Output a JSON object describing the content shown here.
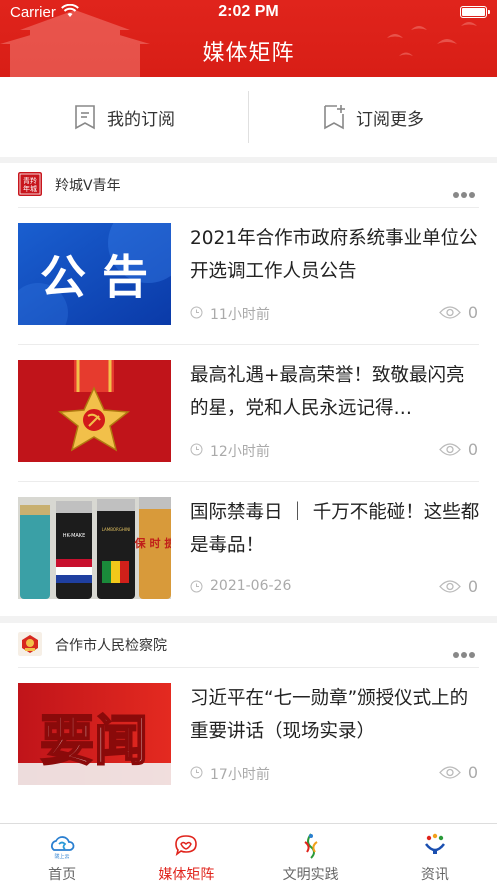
{
  "status_bar": {
    "carrier": "Carrier",
    "time": "2:02 PM"
  },
  "header": {
    "title": "媒体矩阵"
  },
  "subscribe": {
    "mine_label": "我的订阅",
    "more_label": "订阅更多"
  },
  "sections": [
    {
      "name": "羚城V青年",
      "logo_text": "青羚年城",
      "items": [
        {
          "title": "2021年合作市政府系统事业单位公开选调工作人员公告",
          "time": "11小时前",
          "views": "0",
          "thumb_text": "公 告"
        },
        {
          "title": "最高礼遇+最高荣誉！致敬最闪亮的星，党和人民永远记得…",
          "time": "12小时前",
          "views": "0"
        },
        {
          "title": "国际禁毒日 ｜ 千万不能碰！这些都是毒品！",
          "time": "2021-06-26",
          "views": "0",
          "thumb_labels": [
            "HK-MAKE",
            "LAMBORGHINI",
            "保 时 捷"
          ]
        }
      ]
    },
    {
      "name": "合作市人民检察院",
      "items": [
        {
          "title": "习近平在“七一勋章”颁授仪式上的重要讲话（现场实录）",
          "time": "17小时前",
          "views": "0",
          "thumb_text": "要闻"
        }
      ]
    }
  ],
  "tabs": [
    {
      "label": "首页",
      "icon": "home-cloud-icon",
      "active": false,
      "icon_text": "陇上云"
    },
    {
      "label": "媒体矩阵",
      "icon": "media-matrix-icon",
      "active": true
    },
    {
      "label": "文明实践",
      "icon": "civilization-practice-icon",
      "active": false
    },
    {
      "label": "资讯",
      "icon": "news-icon",
      "active": false
    }
  ],
  "colors": {
    "brand_red": "#e0241c",
    "text_dark": "#222222",
    "meta_gray": "#aaaaaa"
  }
}
